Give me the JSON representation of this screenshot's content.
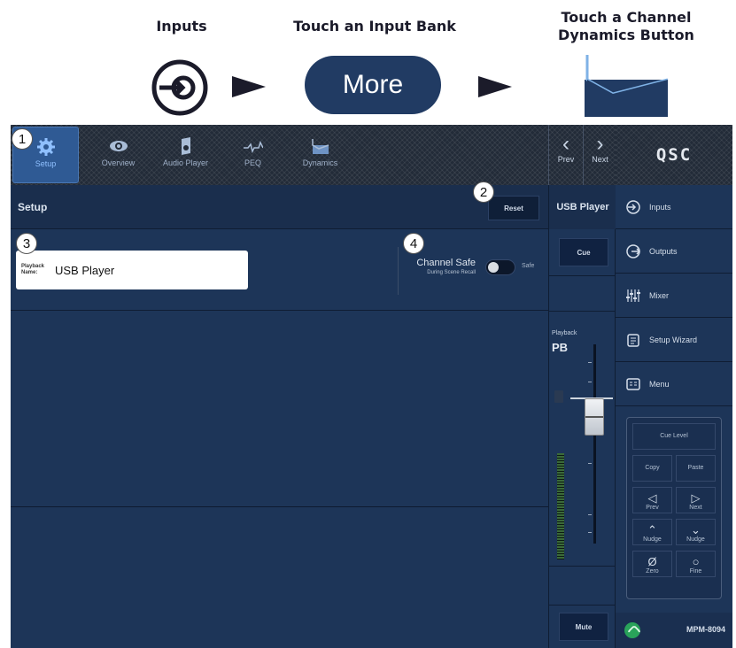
{
  "header": {
    "step1_label": "Inputs",
    "step2_label": "Touch an Input Bank",
    "step3_label_line1": "Touch a Channel",
    "step3_label_line2": "Dynamics Button",
    "more_button": "More",
    "text_color": "#1b1b2a",
    "pill_color": "#213b63"
  },
  "tabs": [
    {
      "label": "Setup",
      "icon": "gear-icon",
      "active": true
    },
    {
      "label": "Overview",
      "icon": "eye-icon",
      "active": false
    },
    {
      "label": "Audio Player",
      "icon": "speaker-icon",
      "active": false
    },
    {
      "label": "PEQ",
      "icon": "peq-curve-icon",
      "active": false
    },
    {
      "label": "Dynamics",
      "icon": "dynamics-icon",
      "active": false
    }
  ],
  "prev_next": {
    "prev": "Prev",
    "next": "Next"
  },
  "brand": "QSC",
  "setup": {
    "title": "Setup",
    "reset": "Reset",
    "name_tag_line1": "Playback",
    "name_tag_line2": "Name:",
    "name_value": "USB Player",
    "channel_safe": "Channel Safe",
    "channel_safe_sub": "During Scene Recall",
    "safe_label": "Safe"
  },
  "strip": {
    "title": "USB Player",
    "cue": "Cue",
    "type_label": "Playback",
    "short_name": "PB",
    "mute": "Mute"
  },
  "nav": [
    {
      "label": "Inputs",
      "icon": "input-arrow-icon"
    },
    {
      "label": "Outputs",
      "icon": "output-arrow-icon"
    },
    {
      "label": "Mixer",
      "icon": "mixer-faders-icon"
    },
    {
      "label": "Setup Wizard",
      "icon": "clipboard-icon"
    },
    {
      "label": "Menu",
      "icon": "menu-icon"
    }
  ],
  "keypad": {
    "cue_level": "Cue Level",
    "copy": "Copy",
    "paste": "Paste",
    "prev": "Prev",
    "next": "Next",
    "nudge_up": "Nudge",
    "nudge_down": "Nudge",
    "zero": "Zero",
    "fine": "Fine"
  },
  "status": {
    "model": "MPM-8094",
    "wifi_color": "#29a35a"
  },
  "callouts": [
    "1",
    "2",
    "3",
    "4"
  ],
  "colors": {
    "panel": "#1d3558",
    "accent": "#2f5a94",
    "bar": "#1a2e4d"
  }
}
